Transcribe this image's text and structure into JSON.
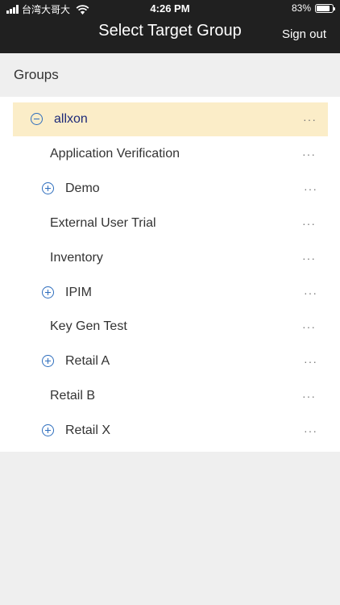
{
  "status_bar": {
    "carrier": "台湾大哥大",
    "time": "4:26 PM",
    "battery_percent": "83%",
    "battery_level": 0.83
  },
  "header": {
    "title": "Select Target Group",
    "sign_out": "Sign out"
  },
  "section": {
    "label": "Groups"
  },
  "groups": [
    {
      "label": "allxon",
      "expander": "minus",
      "selected": true,
      "more": "···"
    },
    {
      "label": "Application Verification",
      "expander": "none",
      "more": "···"
    },
    {
      "label": "Demo",
      "expander": "plus",
      "more": "···"
    },
    {
      "label": "External User Trial",
      "expander": "none",
      "more": "···"
    },
    {
      "label": "Inventory",
      "expander": "none",
      "more": "···"
    },
    {
      "label": "IPIM",
      "expander": "plus",
      "more": "···"
    },
    {
      "label": "Key Gen Test",
      "expander": "none",
      "more": "···"
    },
    {
      "label": "Retail A",
      "expander": "plus",
      "more": "···"
    },
    {
      "label": "Retail B",
      "expander": "none",
      "more": "···"
    },
    {
      "label": "Retail X",
      "expander": "plus",
      "more": "···"
    }
  ],
  "colors": {
    "header_bg": "#202020",
    "selected_row_bg": "#fbedc8",
    "expander_blue": "#2d6dbd",
    "selected_text": "#1e2a78"
  }
}
